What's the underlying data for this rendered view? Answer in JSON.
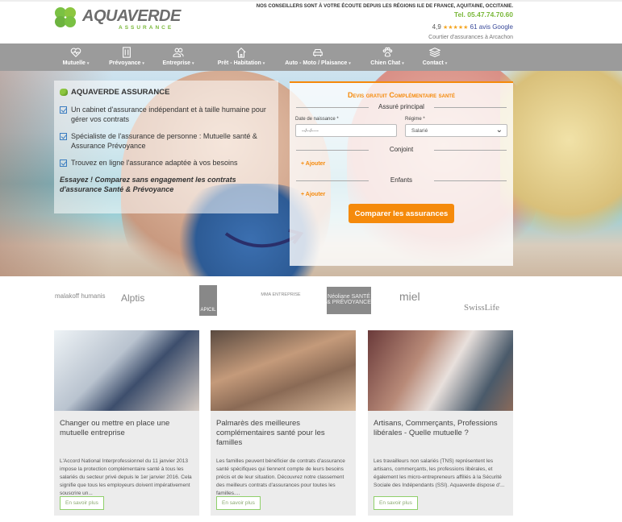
{
  "header": {
    "logo_text": "AQUAVERDE",
    "logo_sub": "ASSURANCE",
    "tagline": "NOS CONSEILLERS SONT À VOTRE ÉCOUTE DEPUIS LES RÉGIONS ILE DE FRANCE, AQUITAINE, OCCITANIE.",
    "phone": "Tel. 05.47.74.70.60",
    "rating": "4,9",
    "stars": "★★★★★",
    "reviews": "61 avis Google",
    "broker": "Courtier d'assurances à Arcachon"
  },
  "nav": [
    {
      "label": "Mutuelle",
      "icon": "heart-pulse-icon"
    },
    {
      "label": "Prévoyance",
      "icon": "building-icon"
    },
    {
      "label": "Entreprise",
      "icon": "users-icon"
    },
    {
      "label": "Prêt - Habitation",
      "icon": "house-icon"
    },
    {
      "label": "Auto - Moto / Plaisance",
      "icon": "car-icon"
    },
    {
      "label": "Chien Chat",
      "icon": "paw-icon"
    },
    {
      "label": "Contact",
      "icon": "layers-icon"
    }
  ],
  "intro": {
    "title": "AQUAVERDE ASSURANCE",
    "items": [
      "Un cabinet d'assurance indépendant et à taille humaine pour gérer vos contrats",
      "Spécialiste de l'assurance de personne : Mutuelle santé & Assurance Prévoyance",
      "Trouvez en ligne l'assurance adaptée à vos besoins"
    ],
    "cta": "Essayez ! Comparez sans engagement  les contrats d'assurance Santé & Prévoyance"
  },
  "form": {
    "title": "Devis gratuit Complémentaire santé",
    "section_main": "Assuré principal",
    "dob_label": "Date de naissance *",
    "dob_placeholder": "--/--/----",
    "regime_label": "Régime *",
    "regime_value": "Salarié",
    "section_spouse": "Conjoint",
    "add_spouse": "Ajouter",
    "section_children": "Enfants",
    "add_children": "Ajouter",
    "submit": "Comparer les assurances",
    "accent": "#f58a0b"
  },
  "partners": [
    "malakoff humanis",
    "Alptis",
    "APICIL",
    "MMA ENTREPRISE",
    "Néoliane SANTÉ & PRÉVOYANCE",
    "miel",
    "SwissLife"
  ],
  "cards": [
    {
      "title": "Changer ou mettre en place une mutuelle entreprise",
      "text": "L'Accord National Interprofessionnel du 11 janvier 2013 impose la protection complémentaire santé à tous les salariés du secteur privé depuis le 1er janvier 2016. Cela signifie que tous les employeurs doivent impérativement souscrire un...",
      "link": "En savoir plus"
    },
    {
      "title": "Palmarès des meilleures complémentaires santé pour les familles",
      "text": "Les familles peuvent bénéficier de contrats d'assurance santé spécifiques qui tiennent compte de leurs besoins précis et de leur situation. Découvrez notre classement des meilleurs contrats d'assurances pour toutes les familles....",
      "link": "En savoir plus"
    },
    {
      "title": "Artisans, Commerçants, Professions libérales - Quelle mutuelle ?",
      "text": "Les travailleurs non salariés (TNS) représentent les artisans, commerçants, les professions libérales, et également les micro-entrepreneurs affiliés à la Sécurité Sociale des Indépendants (SSI). Aquaverde dispose d'...",
      "link": "En savoir plus"
    }
  ]
}
